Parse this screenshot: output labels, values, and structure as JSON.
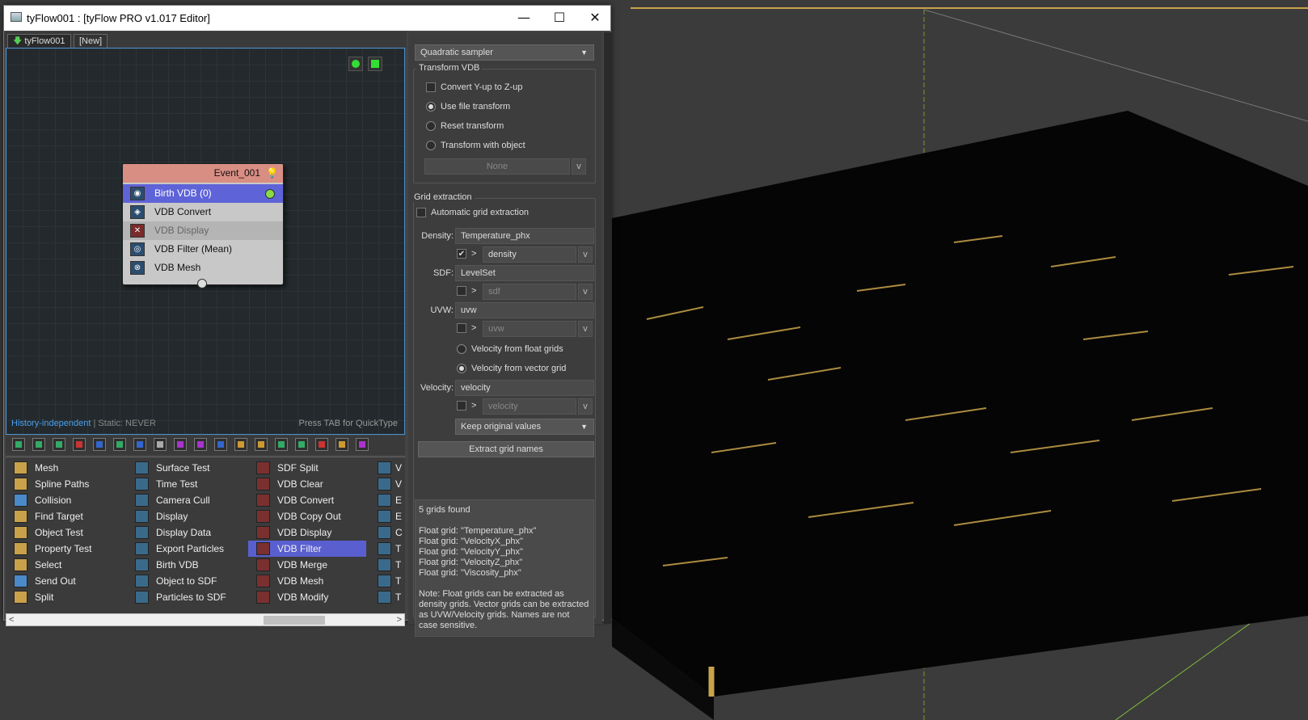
{
  "window": {
    "title": "tyFlow001 : [tyFlow PRO v1.017 Editor]",
    "minimize": "—",
    "maximize": "☐",
    "close": "✕"
  },
  "tabs": [
    {
      "label": "tyFlow001"
    },
    {
      "label": "[New]"
    }
  ],
  "graph": {
    "event": {
      "name": "Event_001",
      "operators": [
        {
          "label": "Birth VDB (0)",
          "state": "selected"
        },
        {
          "label": "VDB Convert",
          "state": "normal"
        },
        {
          "label": "VDB Display",
          "state": "disabled"
        },
        {
          "label": "VDB Filter (Mean)",
          "state": "normal"
        },
        {
          "label": "VDB Mesh",
          "state": "normal"
        }
      ]
    },
    "status_mode": "History-independent",
    "status_static": " | Static: NEVER",
    "quicktype_hint": "Press TAB for QuickType"
  },
  "operator_list": {
    "columns": [
      [
        "Mesh",
        "Spline Paths",
        "Collision",
        "Find Target",
        "Object Test",
        "Property Test",
        "Select",
        "Send Out",
        "Split"
      ],
      [
        "Surface Test",
        "Time Test",
        "Camera Cull",
        "Display",
        "Display Data",
        "Export Particles",
        "Birth VDB",
        "Object to SDF",
        "Particles to SDF"
      ],
      [
        "SDF Split",
        "VDB Clear",
        "VDB Convert",
        "VDB Copy Out",
        "VDB Display",
        "VDB Filter",
        "VDB Merge",
        "VDB Mesh",
        "VDB Modify"
      ]
    ],
    "selected": "VDB Filter",
    "col4_partial": [
      "V",
      "V",
      "E",
      "E",
      "C",
      "T",
      "T",
      "T",
      "T"
    ]
  },
  "panel": {
    "sampler": "Quadratic sampler",
    "transform_group": "Transform VDB",
    "convert_yup": "Convert Y-up to Z-up",
    "use_file_transform": "Use file transform",
    "reset_transform": "Reset transform",
    "transform_with_object": "Transform with object",
    "object_picker": "None",
    "grid_group": "Grid extraction",
    "auto_grid": "Automatic grid extraction",
    "density_label": "Density:",
    "density_value": "Temperature_phx",
    "density_channel": "density",
    "sdf_label": "SDF:",
    "sdf_value": "LevelSet",
    "sdf_channel": "sdf",
    "uvw_label": "UVW:",
    "uvw_value": "uvw",
    "uvw_channel": "uvw",
    "vel_float": "Velocity from float grids",
    "vel_vector": "Velocity from vector grid",
    "velocity_label": "Velocity:",
    "velocity_value": "velocity",
    "velocity_channel": "velocity",
    "keep_values": "Keep original values",
    "extract_button": "Extract grid names",
    "arrow": ">",
    "v": "v",
    "check": "✔",
    "info": "5 grids found\n\nFloat grid: \"Temperature_phx\"\nFloat grid: \"VelocityX_phx\"\nFloat grid: \"VelocityY_phx\"\nFloat grid: \"VelocityZ_phx\"\nFloat grid: \"Viscosity_phx\"\n\nNote: Float grids can be extracted as density grids. Vector grids can be extracted as UVW/Velocity grids. Names are not case sensitive."
  }
}
